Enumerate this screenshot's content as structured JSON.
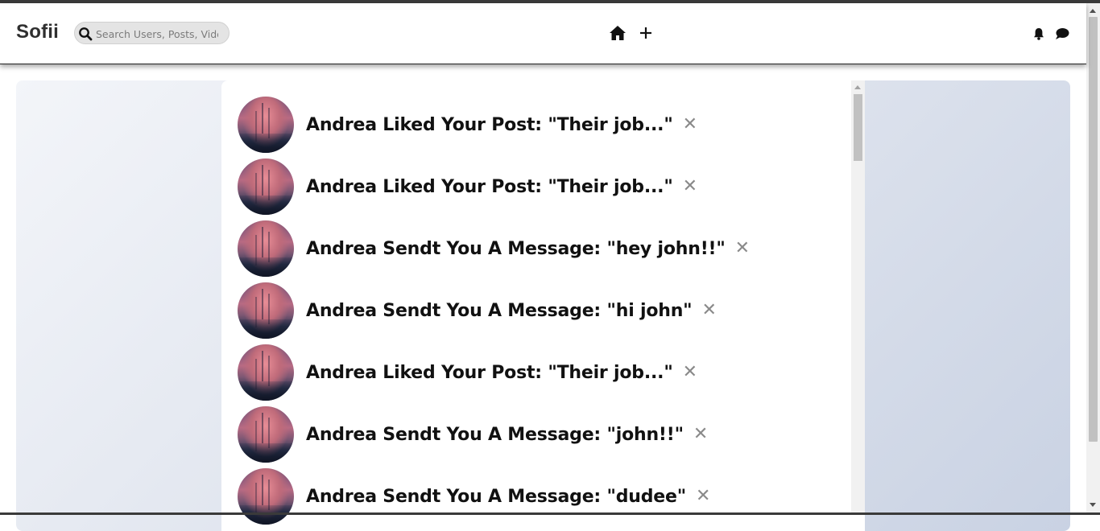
{
  "header": {
    "logo": "Sofii",
    "search": {
      "placeholder": "Search Users, Posts, Videos",
      "value": ""
    },
    "icons": [
      "home-icon",
      "plus-icon",
      "bell-icon",
      "chat-icon"
    ]
  },
  "notifications": [
    {
      "text": "Andrea Liked Your Post: \"Their job...\"",
      "close": "✕"
    },
    {
      "text": "Andrea Liked Your Post: \"Their job...\"",
      "close": "✕"
    },
    {
      "text": "Andrea Sendt You A Message: \"hey john!!\"",
      "close": "✕"
    },
    {
      "text": "Andrea Sendt You A Message: \"hi john\"",
      "close": "✕"
    },
    {
      "text": "Andrea Liked Your Post: \"Their job...\"",
      "close": "✕"
    },
    {
      "text": "Andrea Sendt You A Message: \"john!!\"",
      "close": "✕"
    },
    {
      "text": "Andrea Sendt You A Message: \"dudee\"",
      "close": "✕"
    }
  ],
  "colors": {
    "text": "#111111",
    "close": "#8a8a8a",
    "navbar_bg": "#ffffff",
    "content_gradient": [
      "#f3f5f9",
      "#c9d2e3"
    ]
  }
}
